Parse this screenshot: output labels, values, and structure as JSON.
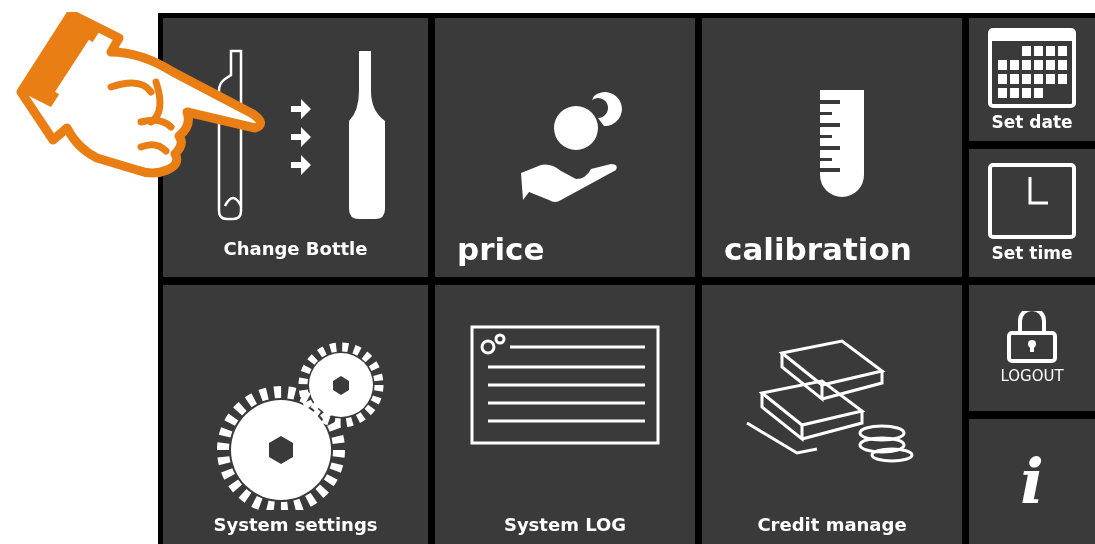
{
  "tiles": [
    {
      "label": "Change Bottle",
      "kind": "small"
    },
    {
      "label": "price",
      "kind": "large"
    },
    {
      "label": "calibration",
      "kind": "large"
    },
    {
      "label": "System settings",
      "kind": "small"
    },
    {
      "label": "System LOG",
      "kind": "small"
    },
    {
      "label": "Credit manage",
      "kind": "small"
    }
  ],
  "side_tiles": [
    {
      "label": "Set date",
      "kind": "label"
    },
    {
      "label": "Set time",
      "kind": "label"
    },
    {
      "label": "LOGOUT",
      "kind": "label"
    },
    {
      "label": "i",
      "kind": "symbol"
    }
  ]
}
